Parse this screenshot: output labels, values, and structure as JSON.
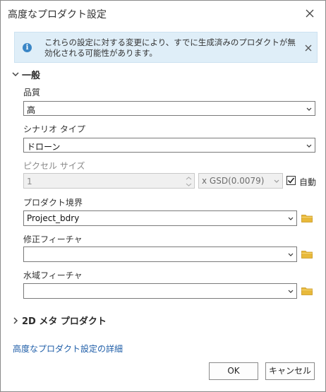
{
  "dialog": {
    "title": "高度なプロダクト設定"
  },
  "notice": {
    "text": "これらの設定に対する変更により、すでに生成済みのプロダクトが無効化される可能性があります。"
  },
  "general_section": {
    "label": "一般",
    "quality": {
      "label": "品質",
      "value": "高"
    },
    "scenario_type": {
      "label": "シナリオ タイプ",
      "value": "ドローン"
    },
    "pixel_size": {
      "label": "ピクセル サイズ",
      "value": "1",
      "unit_value": "x GSD(0.0079)",
      "auto_label": "自動",
      "auto_checked": true
    },
    "product_boundary": {
      "label": "プロダクト境界",
      "value": "Project_bdry"
    },
    "correction_features": {
      "label": "修正フィーチャ",
      "value": ""
    },
    "water_features": {
      "label": "水域フィーチャ",
      "value": ""
    }
  },
  "meta_section": {
    "label": "2D メタ プロダクト"
  },
  "footer": {
    "link_text": "高度なプロダクト設定の詳細",
    "ok_label": "OK",
    "cancel_label": "キャンセル"
  },
  "colors": {
    "notice_bg": "#dfeef8",
    "info_icon": "#3a86c6",
    "link": "#1f5ea8",
    "folder": "#e8b93a"
  },
  "icons": [
    "close-icon",
    "info-icon",
    "chevron-down-icon",
    "chevron-right-icon",
    "folder-icon",
    "checkmark-icon"
  ]
}
